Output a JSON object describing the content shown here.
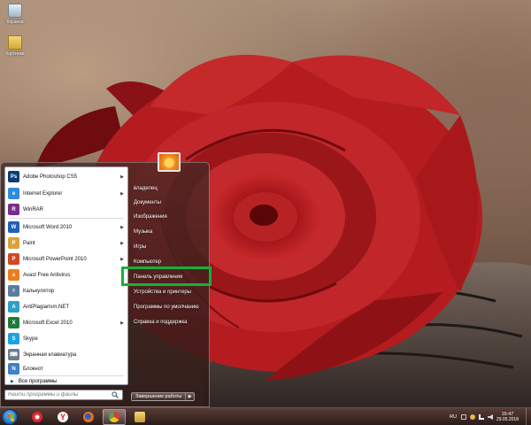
{
  "desktop": {
    "icons": [
      {
        "label": "Корзина",
        "icon": "recycle-bin-icon"
      },
      {
        "label": "Картинки",
        "icon": "folder-icon"
      }
    ]
  },
  "start_menu": {
    "programs": [
      {
        "label": "Adobe Photoshop CS5",
        "icon": "photoshop-icon",
        "badge": "Ps",
        "color": "#0a3c78",
        "submenu": true
      },
      {
        "label": "Internet Explorer",
        "icon": "internet-explorer-icon",
        "badge": "e",
        "color": "#2f8be0",
        "submenu": true
      },
      {
        "label": "WinRAR",
        "icon": "winrar-icon",
        "badge": "R",
        "color": "#7a2b8e",
        "submenu": false
      },
      {
        "label": "Microsoft Word 2010",
        "icon": "word-icon",
        "badge": "W",
        "color": "#1f5fb8",
        "submenu": true
      },
      {
        "label": "Paint",
        "icon": "paint-icon",
        "badge": "P",
        "color": "#d9a23a",
        "submenu": true
      },
      {
        "label": "Microsoft PowerPoint 2010",
        "icon": "powerpoint-icon",
        "badge": "P",
        "color": "#d24726",
        "submenu": true
      },
      {
        "label": "Avast Free Antivirus",
        "icon": "avast-icon",
        "badge": "a",
        "color": "#f07b1a",
        "submenu": false
      },
      {
        "label": "Калькулятор",
        "icon": "calculator-icon",
        "badge": "=",
        "color": "#5a7c9e",
        "submenu": false
      },
      {
        "label": "AntiPlagiarism.NET",
        "icon": "antiplagiarism-icon",
        "badge": "A",
        "color": "#2aa0c8",
        "submenu": false
      },
      {
        "label": "Microsoft Excel 2010",
        "icon": "excel-icon",
        "badge": "X",
        "color": "#1f7a3a",
        "submenu": true
      },
      {
        "label": "Skype",
        "icon": "skype-icon",
        "badge": "S",
        "color": "#1aa2e6",
        "submenu": false
      },
      {
        "label": "Экранная клавиатура",
        "icon": "keyboard-icon",
        "badge": "⌨",
        "color": "#6b7c8c",
        "submenu": false
      },
      {
        "label": "Блокнот",
        "icon": "notepad-icon",
        "badge": "N",
        "color": "#3f7fc4",
        "submenu": false
      }
    ],
    "all_programs": "Все программы",
    "search_placeholder": "Найти программы и файлы",
    "right_items": [
      {
        "label": "владелец",
        "name": "user-folder-link"
      },
      {
        "label": "Документы",
        "name": "documents-link"
      },
      {
        "label": "Изображения",
        "name": "pictures-link"
      },
      {
        "label": "Музыка",
        "name": "music-link"
      },
      {
        "label": "Игры",
        "name": "games-link"
      },
      {
        "label": "Компьютер",
        "name": "computer-link"
      },
      {
        "label": "Панель управления",
        "name": "control-panel-link"
      },
      {
        "label": "Устройства и принтеры",
        "name": "devices-printers-link"
      },
      {
        "label": "Программы по умолчанию",
        "name": "default-programs-link"
      },
      {
        "label": "Справка и поддержка",
        "name": "help-support-link"
      }
    ],
    "highlighted_item": "Панель управления",
    "highlight_color": "#13b23a",
    "shutdown_label": "Завершение работы"
  },
  "taskbar": {
    "pinned": [
      {
        "name": "opera-taskbar-button",
        "icon": "opera-icon",
        "color": "#e3262b",
        "active": false
      },
      {
        "name": "yandex-taskbar-button",
        "icon": "yandex-browser-icon",
        "color": "#f5f5f5",
        "active": false
      },
      {
        "name": "firefox-taskbar-button",
        "icon": "firefox-icon",
        "color": "#f07a1a",
        "active": false
      },
      {
        "name": "chrome-taskbar-button",
        "icon": "chrome-icon",
        "color": "#3fae49",
        "active": true
      },
      {
        "name": "explorer-taskbar-button",
        "icon": "file-explorer-icon",
        "color": "#e9c65a",
        "active": false
      }
    ],
    "language": "RU",
    "time": "16:47",
    "date": "29.05.2018"
  }
}
